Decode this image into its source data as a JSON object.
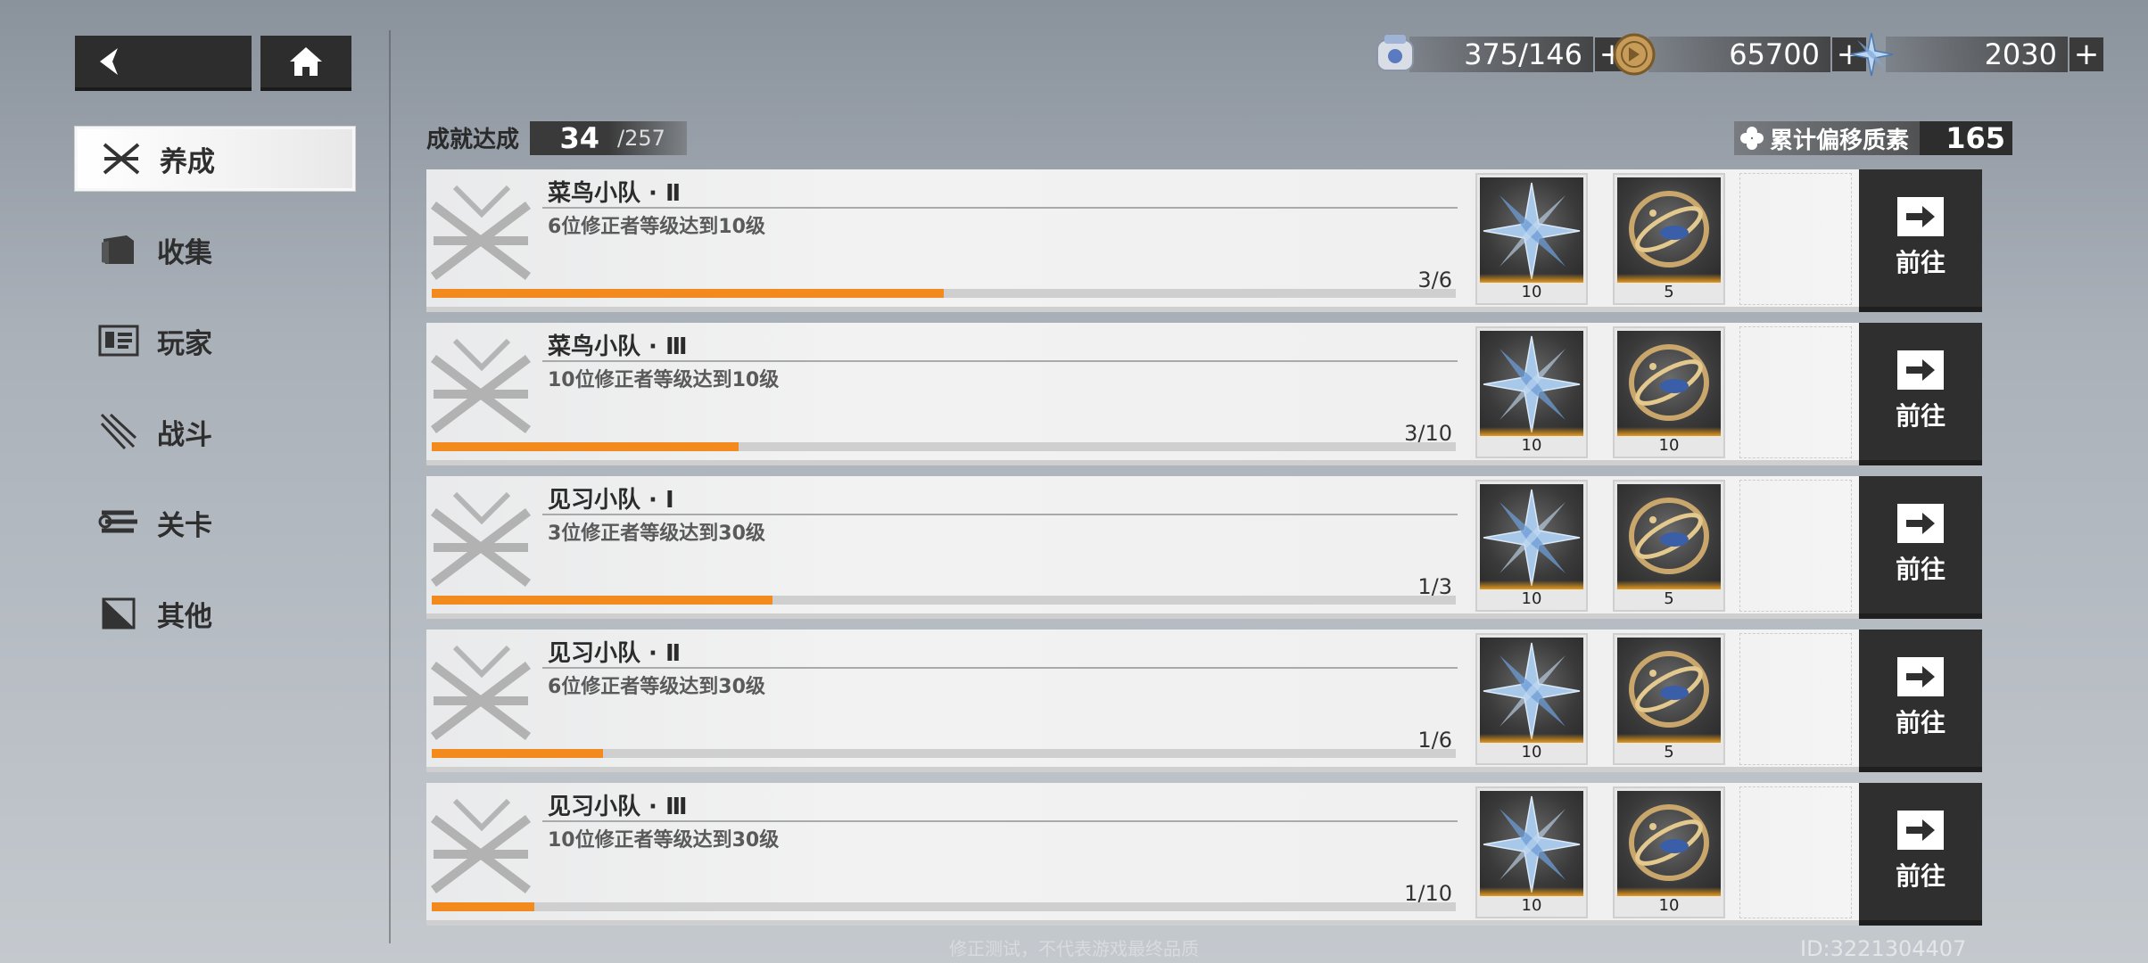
{
  "nav": {
    "back_icon": "chevron-left-icon",
    "home_icon": "home-icon"
  },
  "sidebar": {
    "items": [
      {
        "label": "养成",
        "icon": "cross-swords-icon",
        "active": true
      },
      {
        "label": "收集",
        "icon": "folder-icon",
        "active": false
      },
      {
        "label": "玩家",
        "icon": "id-card-icon",
        "active": false
      },
      {
        "label": "战斗",
        "icon": "blade-icon",
        "active": false
      },
      {
        "label": "关卡",
        "icon": "stack-icon",
        "active": false
      },
      {
        "label": "其他",
        "icon": "triangle-flag-icon",
        "active": false
      }
    ]
  },
  "currency": [
    {
      "icon": "stamina-icon",
      "value": "375/146"
    },
    {
      "icon": "coin-icon",
      "value": "65700"
    },
    {
      "icon": "crystal-icon",
      "value": "2030"
    }
  ],
  "summary": {
    "label": "成就达成",
    "count": "34",
    "total": "/257",
    "offset_label": "累计偏移质素",
    "offset_value": "165"
  },
  "rows": [
    {
      "title": "菜鸟小队 · Ⅱ",
      "desc": "6位修正者等级达到10级",
      "progress_text": "3/6",
      "progress": 0.5,
      "rewards": [
        "10",
        "5"
      ]
    },
    {
      "title": "菜鸟小队 · Ⅲ",
      "desc": "10位修正者等级达到10级",
      "progress_text": "3/10",
      "progress": 0.3,
      "rewards": [
        "10",
        "10"
      ]
    },
    {
      "title": "见习小队 · Ⅰ",
      "desc": "3位修正者等级达到30级",
      "progress_text": "1/3",
      "progress": 0.333,
      "rewards": [
        "10",
        "5"
      ]
    },
    {
      "title": "见习小队 · Ⅱ",
      "desc": "6位修正者等级达到30级",
      "progress_text": "1/6",
      "progress": 0.167,
      "rewards": [
        "10",
        "5"
      ]
    },
    {
      "title": "见习小队 · Ⅲ",
      "desc": "10位修正者等级达到30级",
      "progress_text": "1/10",
      "progress": 0.1,
      "rewards": [
        "10",
        "10"
      ]
    }
  ],
  "goto_label": "前往",
  "footer": {
    "note": "修正测试，不代表游戏最终品质",
    "uid": "ID:3221304407"
  },
  "colors": {
    "progress": "#f28a1e",
    "dark": "#2f2f2f"
  }
}
